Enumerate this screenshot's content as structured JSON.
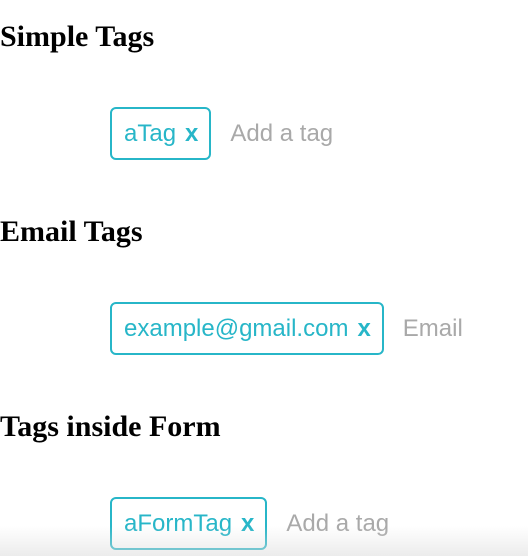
{
  "colors": {
    "accent": "#27b6c8",
    "placeholder": "#a9a9a9",
    "heading": "#000000"
  },
  "sections": [
    {
      "title": "Simple Tags",
      "tag": {
        "label": "aTag",
        "remove": "x"
      },
      "input": {
        "value": "",
        "placeholder": "Add a tag"
      }
    },
    {
      "title": "Email Tags",
      "tag": {
        "label": "example@gmail.com",
        "remove": "x"
      },
      "input": {
        "value": "",
        "placeholder": "Email"
      }
    },
    {
      "title": "Tags inside Form",
      "tag": {
        "label": "aFormTag",
        "remove": "x"
      },
      "input": {
        "value": "",
        "placeholder": "Add a tag"
      }
    }
  ]
}
